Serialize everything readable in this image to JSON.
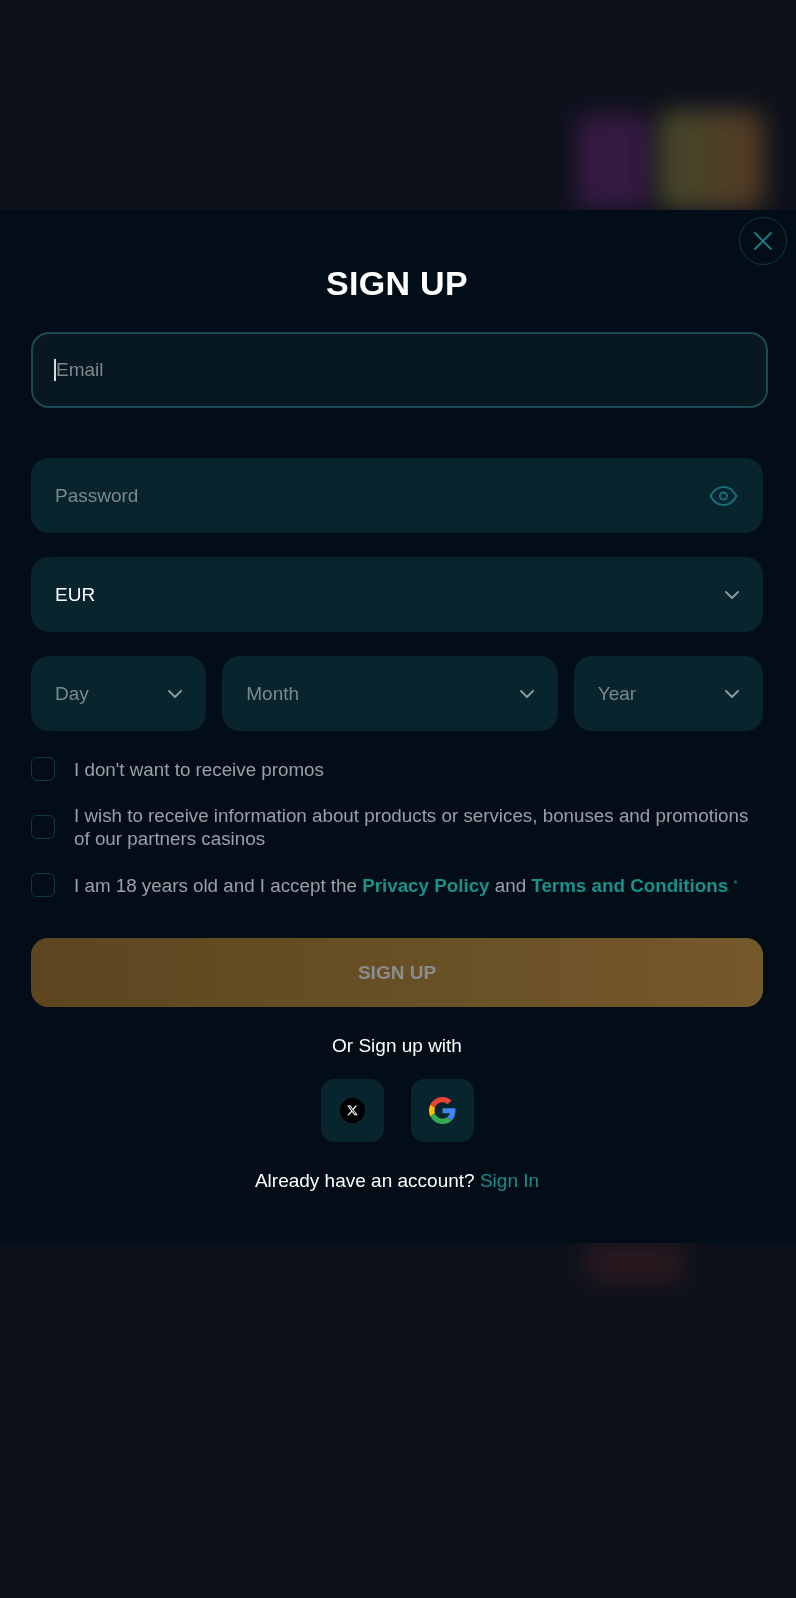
{
  "title": "SIGN UP",
  "fields": [
    {
      "kind": "email",
      "placeholder": "Email",
      "focused": true
    },
    {
      "kind": "password",
      "placeholder": "Password"
    },
    {
      "kind": "select",
      "value": "EUR"
    }
  ],
  "birth_date": [
    {
      "placeholder": "Day"
    },
    {
      "placeholder": "Month"
    },
    {
      "placeholder": "Year"
    }
  ],
  "checkboxes": [
    {
      "label": "I don't want to receive promos",
      "checked": false
    },
    {
      "label": "I wish to receive information about products or services, bonuses and promotions of our partners casinos",
      "checked": false
    },
    {
      "parts": [
        {
          "kind": "text",
          "text": "I am 18 years old and I accept the"
        },
        {
          "kind": "link",
          "text": "Privacy Policy"
        },
        {
          "kind": "text",
          "text": "and"
        },
        {
          "kind": "link",
          "text": "Terms and Conditions"
        },
        {
          "kind": "required",
          "text": "*"
        }
      ],
      "checked": false
    }
  ],
  "submit": {
    "label": "SIGN UP",
    "disabled": true
  },
  "social": {
    "heading": "Or Sign up with",
    "buttons": [
      {
        "kind": "x"
      },
      {
        "kind": "google"
      }
    ]
  },
  "footer": {
    "text": "Already have an account?",
    "link": "Sign In"
  }
}
